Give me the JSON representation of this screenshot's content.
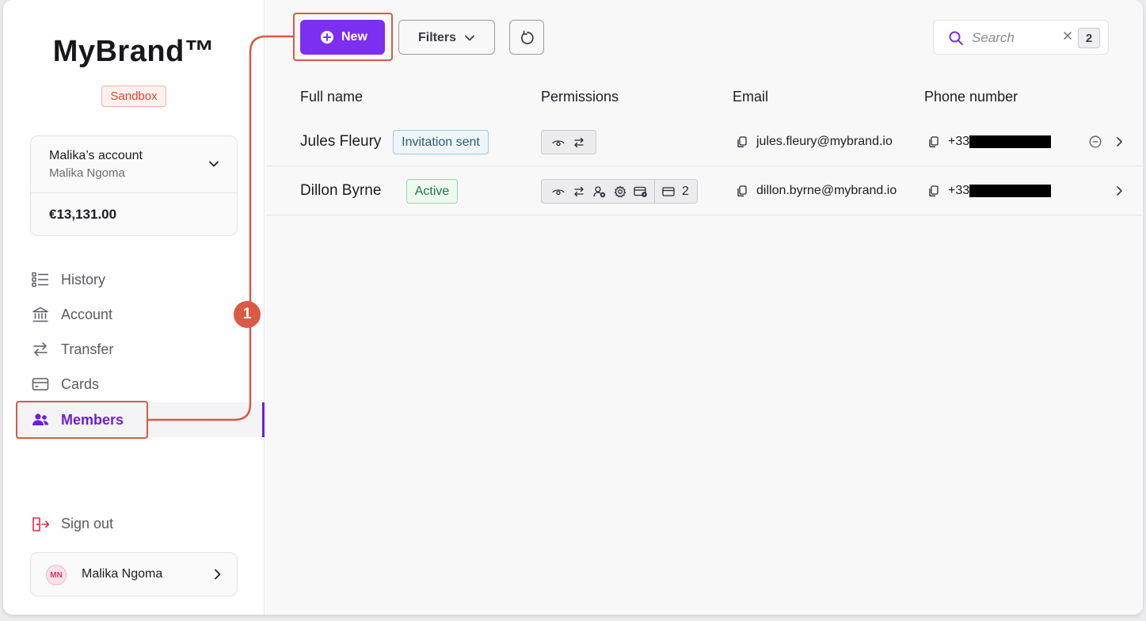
{
  "sidebar": {
    "brand": "MyBrand™",
    "environment_badge": "Sandbox",
    "account_switcher": {
      "account_name": "Malika’s account",
      "owner": "Malika Ngoma",
      "balance": "€13,131.00"
    },
    "nav": [
      {
        "label": "History",
        "icon": "list-icon"
      },
      {
        "label": "Account",
        "icon": "bank-icon"
      },
      {
        "label": "Transfer",
        "icon": "arrows-exchange-icon"
      },
      {
        "label": "Cards",
        "icon": "card-icon"
      },
      {
        "label": "Members",
        "icon": "members-icon",
        "active": true
      }
    ],
    "sign_out": "Sign out",
    "user": {
      "initials": "MN",
      "name": "Malika Ngoma"
    }
  },
  "toolbar": {
    "new_label": "New",
    "filters_label": "Filters",
    "search_placeholder": "Search",
    "search_shortcut": "2"
  },
  "table": {
    "headers": [
      "Full name",
      "Permissions",
      "Email",
      "Phone number"
    ],
    "rows": [
      {
        "name": "Jules Fleury",
        "status": "Invitation sent",
        "permissions": [
          "view-icon",
          "transfer-icon"
        ],
        "email": "jules.fleury@mybrand.io",
        "phone": "+33"
      },
      {
        "name": "Dillon Byrne",
        "status": "Active",
        "permissions": [
          "view-icon",
          "transfer-icon",
          "add-member-icon",
          "settings-icon",
          "card-settings-icon"
        ],
        "cards_count": "2",
        "email": "dillon.byrne@mybrand.io",
        "phone": "+33"
      }
    ]
  },
  "annotation": {
    "step": "1"
  },
  "colors": {
    "accent": "#7c2ff0",
    "annotation": "#d95a45",
    "invite_badge": "#2d5a73",
    "active_badge": "#1f7a3b"
  }
}
